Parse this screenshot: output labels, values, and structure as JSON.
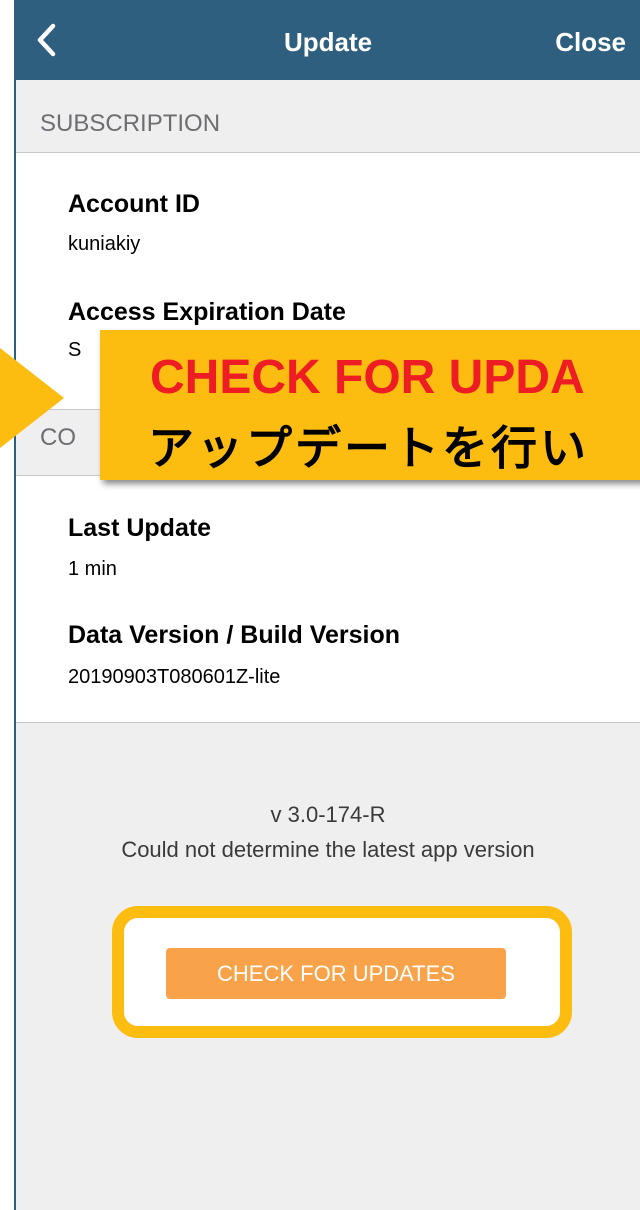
{
  "navbar": {
    "title": "Update",
    "close_label": "Close",
    "back_icon": "chevron-left-icon",
    "color": "#2f5f7f"
  },
  "subscription": {
    "header": "SUBSCRIPTION",
    "account_id_label": "Account ID",
    "account_id_value": "kuniakiy",
    "expiration_label": "Access Expiration Date",
    "expiration_value_partial": "S"
  },
  "contents": {
    "header_partial": "CO",
    "last_update_label": "Last Update",
    "last_update_value": "1 min",
    "version_label": "Data Version / Build Version",
    "version_value": "20190903T080601Z-lite"
  },
  "footer": {
    "app_version": "v 3.0-174-R",
    "status_message": "Could not determine the latest app version",
    "check_button_label": "CHECK FOR UPDATES",
    "button_color": "#f8a34a"
  },
  "callout": {
    "line1": "CHECK FOR UPDA",
    "line2": "アップデートを行い",
    "color": "#fdbd10",
    "text_color": "#ee1d23"
  }
}
